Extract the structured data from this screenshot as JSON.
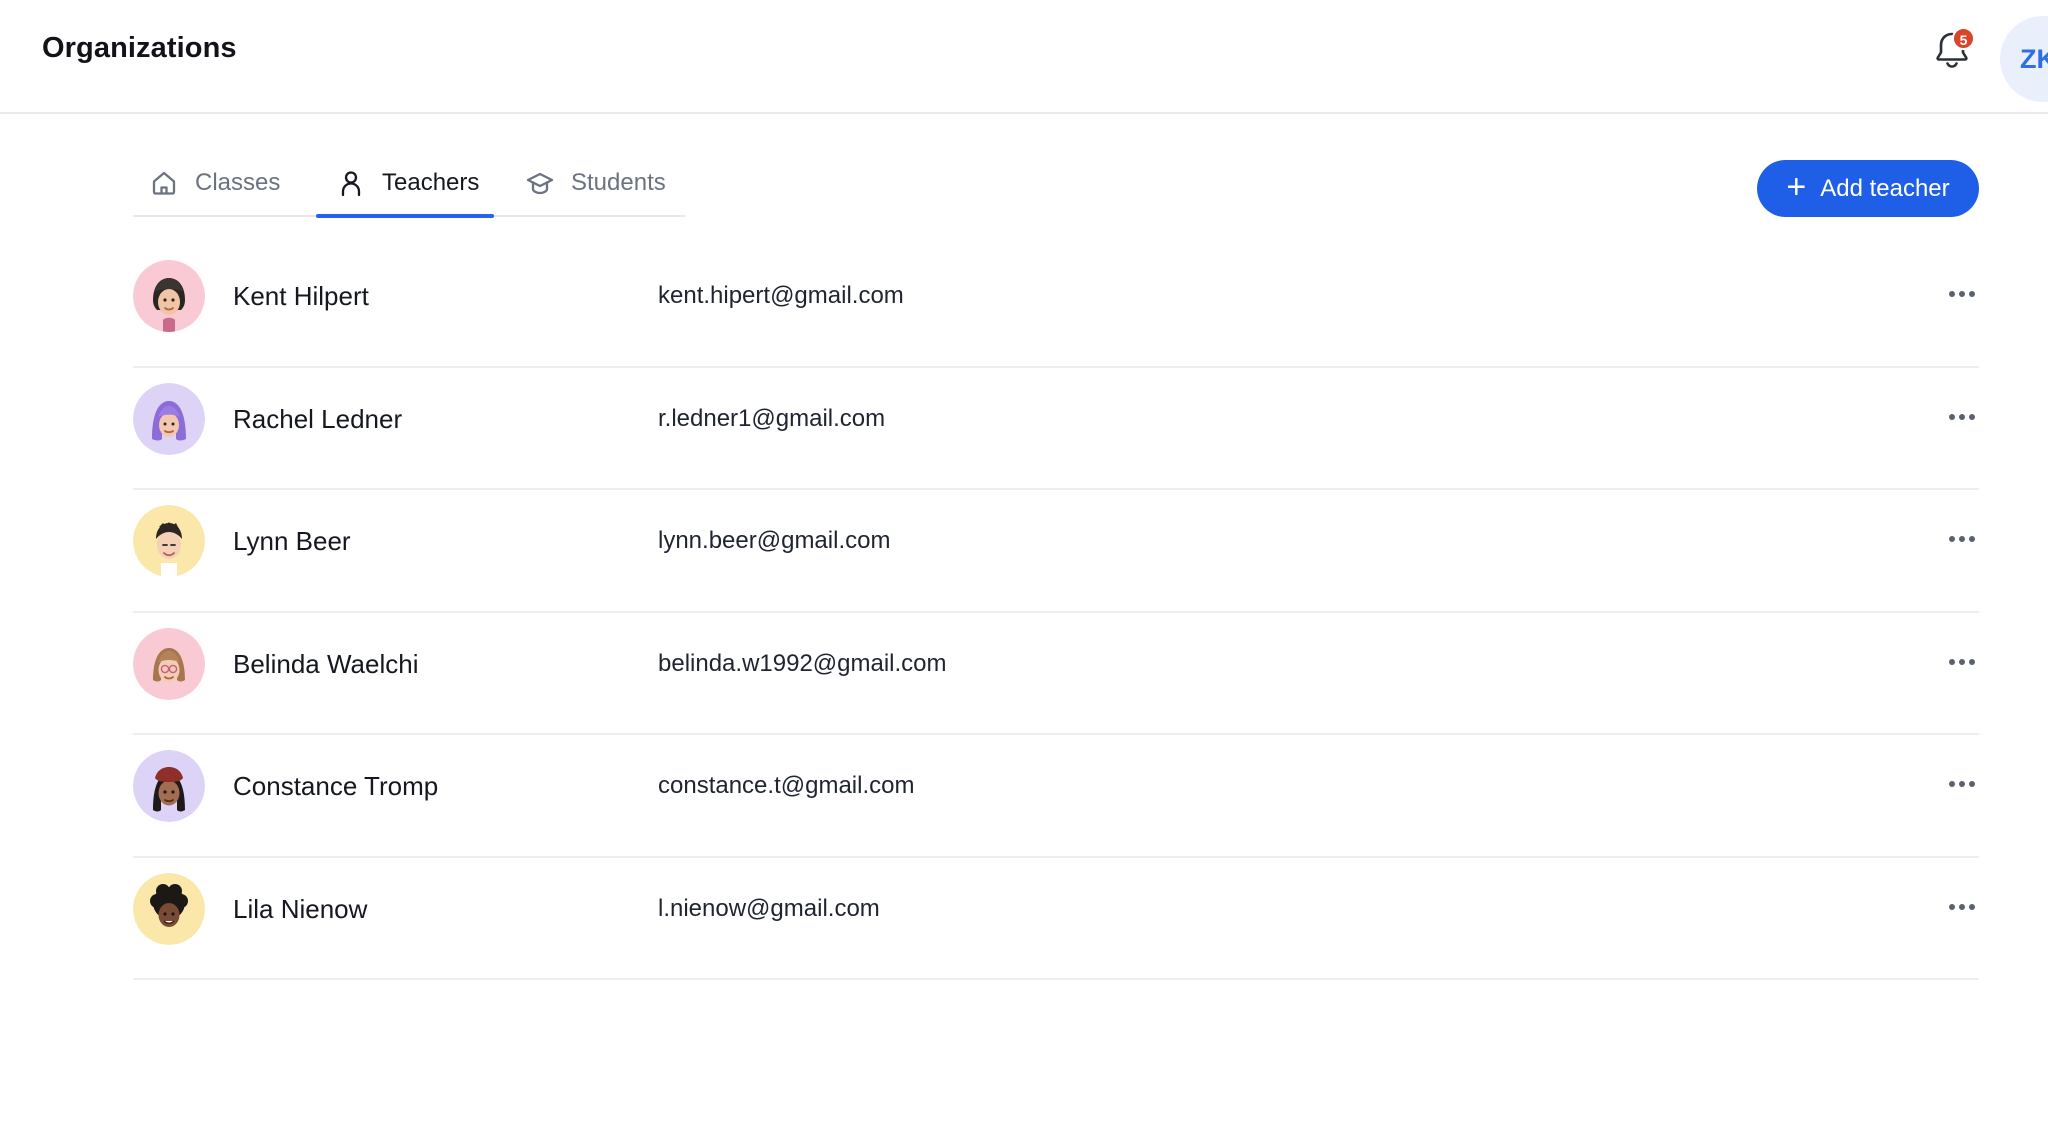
{
  "header": {
    "title": "Organizations",
    "notification_count": "5",
    "user_initials": "ZK"
  },
  "tabs": [
    {
      "label": "Classes",
      "icon": "home-icon",
      "active": false
    },
    {
      "label": "Teachers",
      "icon": "user-icon",
      "active": true
    },
    {
      "label": "Students",
      "icon": "graduation-cap-icon",
      "active": false
    }
  ],
  "actions": {
    "add_label": "Add teacher"
  },
  "teachers": [
    {
      "name": "Kent Hilpert",
      "email": "kent.hipert@gmail.com",
      "avatar_bg": "#f9c9d4"
    },
    {
      "name": "Rachel Ledner",
      "email": "r.ledner1@gmail.com",
      "avatar_bg": "#ddd3f7"
    },
    {
      "name": "Lynn Beer",
      "email": "lynn.beer@gmail.com",
      "avatar_bg": "#fbe7a9"
    },
    {
      "name": "Belinda Waelchi",
      "email": "belinda.w1992@gmail.com",
      "avatar_bg": "#f9c9d4"
    },
    {
      "name": "Constance Tromp",
      "email": "constance.t@gmail.com",
      "avatar_bg": "#ddd3f7"
    },
    {
      "name": "Lila Nienow",
      "email": "l.nienow@gmail.com",
      "avatar_bg": "#fbe7a9"
    }
  ],
  "colors": {
    "accent": "#1f5fe8",
    "badge": "#d9442b"
  }
}
